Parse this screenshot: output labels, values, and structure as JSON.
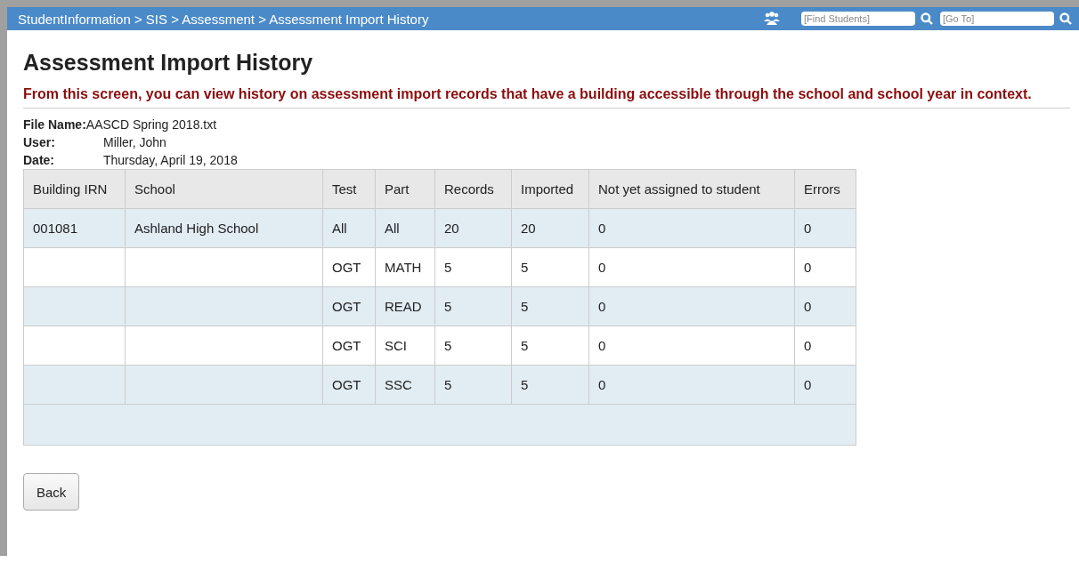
{
  "topbar": {
    "breadcrumb": "StudentInformation > SIS > Assessment > Assessment Import History",
    "find_students": {
      "placeholder": "[Find Students]"
    },
    "go_to": {
      "placeholder": "[Go To]"
    }
  },
  "title": "Assessment Import History",
  "description": "From this screen, you can view history on assessment import records that have a building accessible through the school and school year in context.",
  "details": [
    {
      "label": "File Name:",
      "value": "AASCD Spring 2018.txt",
      "kind": "inline"
    },
    {
      "label": "User:",
      "value": "Miller, John",
      "kind": "aligned"
    },
    {
      "label": "Date:",
      "value": "Thursday, April 19, 2018",
      "kind": "aligned"
    }
  ],
  "table": {
    "columns": [
      "Building IRN",
      "School",
      "Test",
      "Part",
      "Records",
      "Imported",
      "Not yet assigned to student",
      "Errors"
    ],
    "rows": [
      [
        "001081",
        "Ashland High School",
        "All",
        "All",
        "20",
        "20",
        "0",
        "0"
      ],
      [
        null,
        null,
        "OGT",
        "MATH",
        "5",
        "5",
        "0",
        "0"
      ],
      [
        null,
        null,
        "OGT",
        "READ",
        "5",
        "5",
        "0",
        "0"
      ],
      [
        null,
        null,
        "OGT",
        "SCI",
        "5",
        "5",
        "0",
        "0"
      ],
      [
        null,
        null,
        "OGT",
        "SSC",
        "5",
        "5",
        "0",
        "0"
      ]
    ]
  },
  "buttons": [
    "Back"
  ]
}
